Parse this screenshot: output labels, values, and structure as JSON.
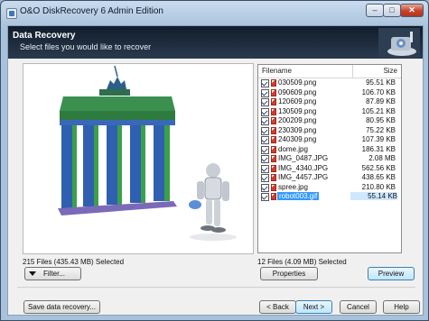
{
  "window": {
    "title": "O&O DiskRecovery 6 Admin Edition"
  },
  "window_controls": {
    "minimize": "–",
    "maximize": "□",
    "close": "✕"
  },
  "header": {
    "title": "Data Recovery",
    "subtitle": "Select files you would like to recover"
  },
  "file_list": {
    "columns": {
      "name": "Filename",
      "size": "Size"
    },
    "rows": [
      {
        "name": "030509.png",
        "size": "95.51 KB"
      },
      {
        "name": "090609.png",
        "size": "106.70 KB"
      },
      {
        "name": "120609.png",
        "size": "87.89 KB"
      },
      {
        "name": "130509.png",
        "size": "105.21 KB"
      },
      {
        "name": "200209.png",
        "size": "80.95 KB"
      },
      {
        "name": "230309.png",
        "size": "75.22 KB"
      },
      {
        "name": "240309.png",
        "size": "107.39 KB"
      },
      {
        "name": "dome.jpg",
        "size": "186.31 KB"
      },
      {
        "name": "IMG_0487.JPG",
        "size": "2.08 MB"
      },
      {
        "name": "IMG_4340.JPG",
        "size": "562.56 KB"
      },
      {
        "name": "IMG_4457.JPG",
        "size": "438.65 KB"
      },
      {
        "name": "spree.jpg",
        "size": "210.80 KB"
      },
      {
        "name": "robot003.gif",
        "size": "55.14 KB"
      }
    ]
  },
  "status": {
    "left": "215 Files (435.43 MB) Selected",
    "right": "12 Files (4.09 MB) Selected"
  },
  "buttons": {
    "filter": "Filter...",
    "properties": "Properties",
    "preview": "Preview",
    "save": "Save data recovery...",
    "back": "< Back",
    "next": "Next >",
    "cancel": "Cancel",
    "help": "Help"
  }
}
